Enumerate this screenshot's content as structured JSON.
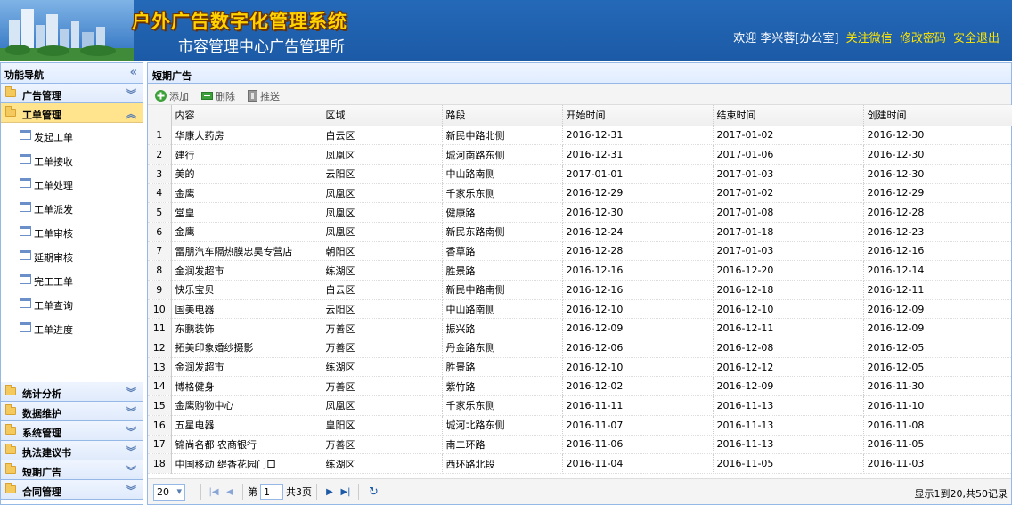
{
  "header": {
    "title": "户外广告数字化管理系统",
    "subtitle": "市容管理中心广告管理所",
    "welcome": "欢迎 李兴蓉[办公室]",
    "links": [
      "关注微信",
      "修改密码",
      "安全退出"
    ]
  },
  "sidebar": {
    "title": "功能导航",
    "collapse_icon": "«",
    "groups_top": [
      {
        "label": "广告管理",
        "active": false
      },
      {
        "label": "工单管理",
        "active": true
      }
    ],
    "sub_items": [
      "发起工单",
      "工单接收",
      "工单处理",
      "工单派发",
      "工单审核",
      "延期审核",
      "完工工单",
      "工单查询",
      "工单进度"
    ],
    "groups_bottom": [
      "统计分析",
      "数据维护",
      "系统管理",
      "执法建议书",
      "短期广告",
      "合同管理"
    ]
  },
  "panel": {
    "title": "短期广告",
    "toolbar": {
      "add": "添加",
      "delete": "删除",
      "push": "推送"
    }
  },
  "table": {
    "columns": [
      "内容",
      "区域",
      "路段",
      "开始时间",
      "结束时间",
      "创建时间"
    ],
    "rows": [
      [
        "1",
        "华康大药房",
        "白云区",
        "新民中路北侧",
        "2016-12-31",
        "2017-01-02",
        "2016-12-30"
      ],
      [
        "2",
        "建行",
        "凤凰区",
        "城河南路东侧",
        "2016-12-31",
        "2017-01-06",
        "2016-12-30"
      ],
      [
        "3",
        "美的",
        "云阳区",
        "中山路南侧",
        "2017-01-01",
        "2017-01-03",
        "2016-12-30"
      ],
      [
        "4",
        "金鹰",
        "凤凰区",
        "千家乐东侧",
        "2016-12-29",
        "2017-01-02",
        "2016-12-29"
      ],
      [
        "5",
        "堂皇",
        "凤凰区",
        "健康路",
        "2016-12-30",
        "2017-01-08",
        "2016-12-28"
      ],
      [
        "6",
        "金鹰",
        "凤凰区",
        "新民东路南侧",
        "2016-12-24",
        "2017-01-18",
        "2016-12-23"
      ],
      [
        "7",
        "雷朋汽车隔热膜忠昊专营店",
        "朝阳区",
        "香草路",
        "2016-12-28",
        "2017-01-03",
        "2016-12-16"
      ],
      [
        "8",
        "金润发超市",
        "练湖区",
        "胜景路",
        "2016-12-16",
        "2016-12-20",
        "2016-12-14"
      ],
      [
        "9",
        "快乐宝贝",
        "白云区",
        "新民中路南侧",
        "2016-12-16",
        "2016-12-18",
        "2016-12-11"
      ],
      [
        "10",
        "国美电器",
        "云阳区",
        "中山路南侧",
        "2016-12-10",
        "2016-12-10",
        "2016-12-09"
      ],
      [
        "11",
        "东鹏装饰",
        "万善区",
        "振兴路",
        "2016-12-09",
        "2016-12-11",
        "2016-12-09"
      ],
      [
        "12",
        "拓美印象婚纱摄影",
        "万善区",
        "丹金路东侧",
        "2016-12-06",
        "2016-12-08",
        "2016-12-05"
      ],
      [
        "13",
        "金润发超市",
        "练湖区",
        "胜景路",
        "2016-12-10",
        "2016-12-12",
        "2016-12-05"
      ],
      [
        "14",
        "博格健身",
        "万善区",
        "紫竹路",
        "2016-12-02",
        "2016-12-09",
        "2016-11-30"
      ],
      [
        "15",
        "金鹰购物中心",
        "凤凰区",
        "千家乐东侧",
        "2016-11-11",
        "2016-11-13",
        "2016-11-10"
      ],
      [
        "16",
        "五星电器",
        "皇阳区",
        "城河北路东侧",
        "2016-11-07",
        "2016-11-13",
        "2016-11-08"
      ],
      [
        "17",
        "锦尚名都 农商银行",
        "万善区",
        "南二环路",
        "2016-11-06",
        "2016-11-13",
        "2016-11-05"
      ],
      [
        "18",
        "中国移动 缇香花园门口",
        "练湖区",
        "西环路北段",
        "2016-11-04",
        "2016-11-05",
        "2016-11-03"
      ]
    ]
  },
  "pager": {
    "page_size": "20",
    "page_prefix": "第",
    "page_value": "1",
    "page_suffix": "共3页",
    "info": "显示1到20,共50记录"
  }
}
